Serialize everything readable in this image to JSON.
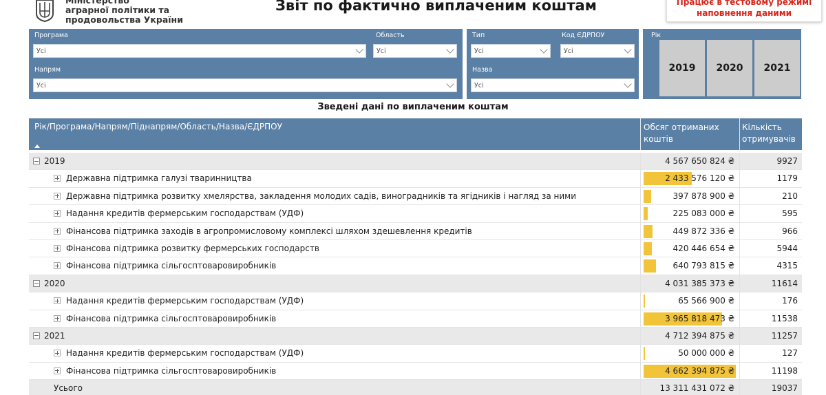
{
  "header": {
    "ministry_line1": "Міністерство",
    "ministry_line2": "аграрної політики та",
    "ministry_line3": "продовольства України",
    "title": "Звіт по фактично виплаченим коштам",
    "notice_line1": "Працює в тестовому режимі",
    "notice_line2": "наповнення даними"
  },
  "filters": {
    "program": {
      "label": "Програма",
      "value": "Усі"
    },
    "region": {
      "label": "Область",
      "value": "Усі"
    },
    "type": {
      "label": "Тип",
      "value": "Усі"
    },
    "edrpou": {
      "label": "Код ЄДРПОУ",
      "value": "Усі"
    },
    "direction": {
      "label": "Напрям",
      "value": "Усі"
    },
    "name": {
      "label": "Назва",
      "value": "Усі"
    },
    "year": {
      "label": "Рік",
      "options": [
        "2019",
        "2020",
        "2021"
      ]
    }
  },
  "table": {
    "title": "Зведені дані по виплаченим коштам",
    "col1": "Рік/Програма/Напрям/Піднапрям/Область/Назва/ЄДРПОУ",
    "col2": "Обсяг отриманих коштів",
    "col3": "Кількість отримувачів",
    "rows": [
      {
        "type": "group",
        "label": "2019",
        "amount": "4 567 650 824 ₴",
        "count": "9927",
        "share": 0
      },
      {
        "type": "child",
        "label": "Державна підтримка галузі тваринництва",
        "amount": "2 433 576 120 ₴",
        "count": "1179",
        "share": 0.52
      },
      {
        "type": "child",
        "label": "Державна підтримка розвитку хмелярства, закладення молодих садів, виноградників та ягідників і нагляд за ними",
        "amount": "397 878 900 ₴",
        "count": "210",
        "share": 0.085
      },
      {
        "type": "child",
        "label": "Надання кредитів фермерським господарствам (УДФ)",
        "amount": "225 083 000 ₴",
        "count": "595",
        "share": 0.048
      },
      {
        "type": "child",
        "label": "Фінансова підтримка заходів в агропромисловому комплексі шляхом здешевлення кредитів",
        "amount": "449 872 336 ₴",
        "count": "966",
        "share": 0.096
      },
      {
        "type": "child",
        "label": "Фінансова підтримка розвитку фермерських господарств",
        "amount": "420 446 654 ₴",
        "count": "5944",
        "share": 0.09
      },
      {
        "type": "child",
        "label": "Фінансова підтримка сільгоспто­варовиробників",
        "amount": "640 793 815 ₴",
        "count": "4315",
        "share": 0.137
      },
      {
        "type": "group",
        "label": "2020",
        "amount": "4 031 385 373 ₴",
        "count": "11614",
        "share": 0
      },
      {
        "type": "child",
        "label": "Надання кредитів фермерським господарствам (УДФ)",
        "amount": "65 566 900 ₴",
        "count": "176",
        "share": 0.014
      },
      {
        "type": "child",
        "label": "Фінансова підтримка сільгоспто­варовиробників",
        "amount": "3 965 818 473 ₴",
        "count": "11538",
        "share": 0.85
      },
      {
        "type": "group",
        "label": "2021",
        "amount": "4 712 394 875 ₴",
        "count": "11257",
        "share": 0
      },
      {
        "type": "child",
        "label": "Надання кредитів фермерським господарствам (УДФ)",
        "amount": "50 000 000 ₴",
        "count": "127",
        "share": 0.011
      },
      {
        "type": "child",
        "label": "Фінансова підтримка сільгоспто­варовиробників",
        "amount": "4 662 394 875 ₴",
        "count": "11198",
        "share": 1.0
      },
      {
        "type": "total",
        "label": "Усього",
        "amount": "13 311 431 072 ₴",
        "count": "19037",
        "share": 0
      }
    ]
  },
  "colors": {
    "panel": "#5b80a5",
    "bar": "#f2c43a",
    "notice": "#d9261c"
  }
}
